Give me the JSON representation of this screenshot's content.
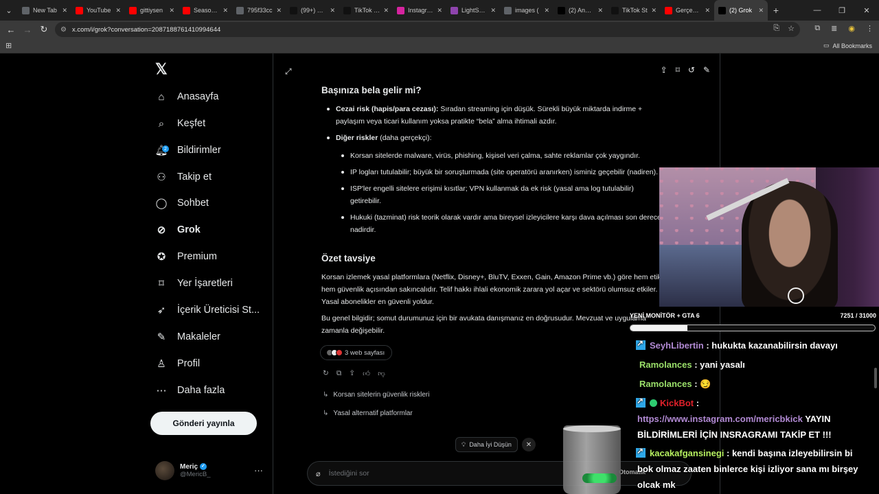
{
  "browser": {
    "tabs": [
      {
        "title": "New Tab",
        "icon": "chrome-icon",
        "color": "#5f6368"
      },
      {
        "title": "YouTube",
        "icon": "youtube-icon",
        "color": "#ff0000"
      },
      {
        "title": "gittiysen",
        "icon": "youtube-icon",
        "color": "#ff0000"
      },
      {
        "title": "Season 4",
        "icon": "youtube-icon",
        "color": "#ff0000"
      },
      {
        "title": "795f33cc",
        "icon": "globe-icon",
        "color": "#5f6368"
      },
      {
        "title": "(99+) TikT",
        "icon": "tiktok-icon",
        "color": "#111111"
      },
      {
        "title": "TikTok - M",
        "icon": "tiktok-icon",
        "color": "#111111"
      },
      {
        "title": "Instagram",
        "icon": "instagram-icon",
        "color": "#d6249f"
      },
      {
        "title": "LightShot",
        "icon": "lightshot-icon",
        "color": "#8e44ad"
      },
      {
        "title": "images (",
        "icon": "globe-icon",
        "color": "#5f6368"
      },
      {
        "title": "(2) Anasa",
        "icon": "x-icon",
        "color": "#000000"
      },
      {
        "title": "TikTok St",
        "icon": "tiktok-icon",
        "color": "#111111"
      },
      {
        "title": "Gerçek H",
        "icon": "youtube-icon",
        "color": "#ff0000"
      },
      {
        "title": "(2) Grok",
        "icon": "x-icon",
        "color": "#000000",
        "active": true
      }
    ],
    "url": "x.com/i/grok?conversation=2087188761410994644",
    "bookmarks_label": "All Bookmarks"
  },
  "sidebar": {
    "logo": "𝕏",
    "items": [
      {
        "label": "Anasayfa",
        "icon": "home-icon",
        "glyph": "⌂"
      },
      {
        "label": "Keşfet",
        "icon": "search-icon",
        "glyph": "⌕"
      },
      {
        "label": "Bildirimler",
        "icon": "bell-icon",
        "glyph": "🔔︎",
        "badge": "2"
      },
      {
        "label": "Takip et",
        "icon": "follow-icon",
        "glyph": "⚇"
      },
      {
        "label": "Sohbet",
        "icon": "chat-icon",
        "glyph": "◯"
      },
      {
        "label": "Grok",
        "icon": "grok-icon",
        "glyph": "⊘",
        "active": true
      },
      {
        "label": "Premium",
        "icon": "premium-icon",
        "glyph": "✪"
      },
      {
        "label": "Yer İşaretleri",
        "icon": "bookmark-icon",
        "glyph": "⌑"
      },
      {
        "label": "İçerik Üreticisi St...",
        "icon": "rocket-icon",
        "glyph": "➶"
      },
      {
        "label": "Makaleler",
        "icon": "article-icon",
        "glyph": "✎"
      },
      {
        "label": "Profil",
        "icon": "profile-icon",
        "glyph": "♙"
      },
      {
        "label": "Daha fazla",
        "icon": "more-circle-icon",
        "glyph": "⋯"
      }
    ],
    "post_button": "Gönderi yayınla",
    "account": {
      "name": "Meriç",
      "handle": "@MericB_"
    }
  },
  "conversation": {
    "h_trouble": "Başınıza bela gelir mi?",
    "b1_bold": "Cezai risk (hapis/para cezası):",
    "b1_line1": " Sıradan streaming için düşük. Sürekli büyük miktarda indirme +",
    "b1_line2": "paylaşım veya ticari kullanım yoksa pratikte “bela” alma ihtimali azdır.",
    "b2_bold": "Diğer riskler",
    "b2_rest": " (daha gerçekçi):",
    "sub1": "Korsan sitelerde malware, virüs, phishing, kişisel veri çalma, sahte reklamlar çok yaygındır.",
    "sub2": "IP logları tutulabilir; büyük bir soruşturmada (site operatörü aranırken) isminiz geçebilir (nadiren).",
    "sub3_line1": "ISP'ler engelli sitelere erişimi kısıtlar; VPN kullanmak da ek risk (yasal ama log tutulabilir)",
    "sub3_line2": "getirebilir.",
    "sub4_line1": "Hukuki (tazminat) risk teorik olarak vardır ama bireysel izleyicilere karşı dava açılması son derece",
    "sub4_line2": "nadirdir.",
    "h_summary": "Özet tavsiye",
    "p1_line1": "Korsan izlemek yasal platformlara (Netflix, Disney+, BluTV, Exxen, Gain, Amazon Prime vb.) göre hem etik",
    "p1_line2": "hem güvenlik açısından sakıncalıdır. Telif hakkı ihlali ekonomik zarara yol açar ve sektörü olumsuz etkiler.",
    "p1_line3": "Yasal abonelikler en güvenli yoldur.",
    "p2_line1": "Bu genel bilgidir; somut durumunuz için bir avukata danışmanız en doğrusudur. Mevzuat ve uygulama",
    "p2_line2": "zamanla değişebilir.",
    "sources_label": "3 web sayfası",
    "followups": [
      "Korsan sitelerin güvenlik riskleri",
      "Yasal alternatif platformlar"
    ],
    "think_label": "Daha İyi Düşün",
    "ask_placeholder": "İstediğini sor",
    "mode_label": "Otomatik"
  },
  "stream_overlay": {
    "goal_label": "YENİ MONİTÖR + GTA 6",
    "goal_count": "7251 / 31000",
    "goal_progress": 0.234,
    "chat": [
      {
        "user": "SeyhLibertin",
        "text": " : hukukta kazanabilirsin davayı"
      },
      {
        "user": "Ramolances",
        "text": " : yani yasalı"
      },
      {
        "user": "Ramolances",
        "text": " : 😏"
      },
      {
        "user": "KickBot",
        "text": " :"
      },
      {
        "link": "https://www.instagram.com/mericbkick",
        "text": " YAYIN"
      },
      {
        "text": "BİLDİRİMLERİ İÇİN INSRAGRAMI TAKİP ET !!!"
      },
      {
        "user": "kacakafgansinegi",
        "text": " : kendi başına izleyebilirsin bi"
      },
      {
        "text": "bok olmaz zaaten binlerce kişi izliyor sana mı birşey"
      },
      {
        "text": "olcak mk"
      }
    ]
  }
}
